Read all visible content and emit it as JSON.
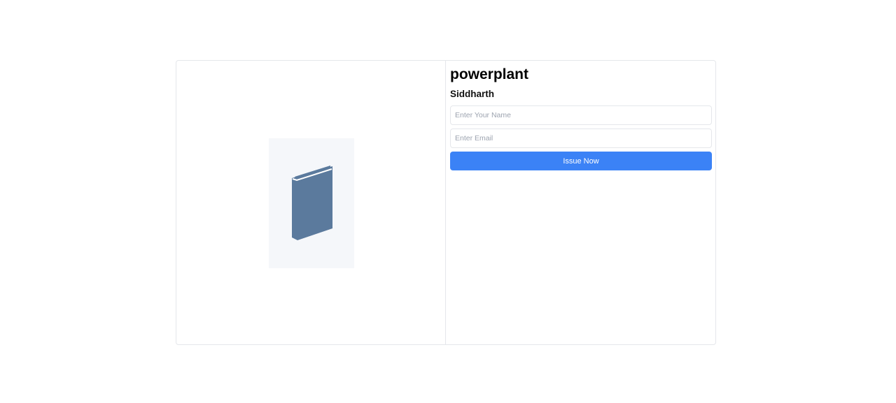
{
  "book": {
    "title": "powerplant",
    "author": "Siddharth",
    "cover_icon": "book-icon",
    "cover_color": "#5b7a9d"
  },
  "form": {
    "name_placeholder": "Enter Your Name",
    "name_value": "",
    "email_placeholder": "Enter Email",
    "email_value": "",
    "issue_label": "Issue Now"
  },
  "colors": {
    "accent": "#3b82f6",
    "border": "#e5e7eb",
    "cover_bg": "#f5f7fa"
  }
}
